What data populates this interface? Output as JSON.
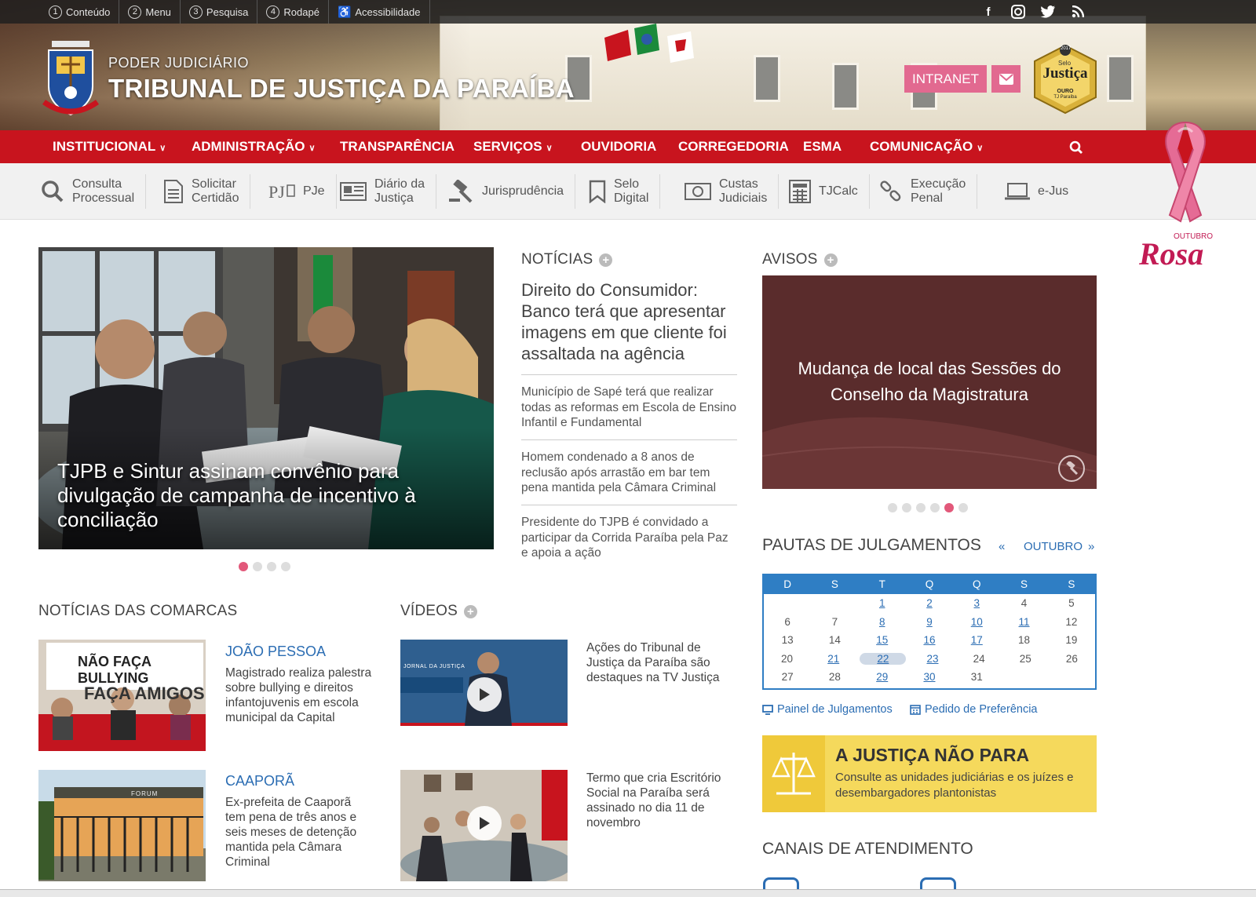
{
  "topbar": {
    "items": [
      {
        "num": "1",
        "label": "Conteúdo"
      },
      {
        "num": "2",
        "label": "Menu"
      },
      {
        "num": "3",
        "label": "Pesquisa"
      },
      {
        "num": "4",
        "label": "Rodapé"
      },
      {
        "num": "",
        "label": "Acessibilidade"
      }
    ],
    "social": [
      "facebook-icon",
      "instagram-icon",
      "twitter-icon",
      "rss-icon"
    ]
  },
  "header": {
    "line1": "PODER JUDICIÁRIO",
    "line2": "TRIBUNAL DE JUSTIÇA DA PARAÍBA",
    "intranet": "INTRANET",
    "seal": {
      "top": "Selo",
      "main": "Justiça",
      "year": "2017",
      "level": "OURO",
      "sub": "TJ Paraíba"
    }
  },
  "nav": {
    "items": [
      {
        "label": "INSTITUCIONAL",
        "dropdown": true
      },
      {
        "label": "ADMINISTRAÇÃO",
        "dropdown": true
      },
      {
        "label": "TRANSPARÊNCIA",
        "dropdown": false
      },
      {
        "label": "SERVIÇOS",
        "dropdown": true
      },
      {
        "label": "OUVIDORIA",
        "dropdown": false
      },
      {
        "label": "CORREGEDORIA",
        "dropdown": false
      },
      {
        "label": "ESMA",
        "dropdown": false
      },
      {
        "label": "COMUNICAÇÃO",
        "dropdown": true
      }
    ]
  },
  "services": [
    {
      "l1": "Consulta",
      "l2": "Processual",
      "icon": "search-icon"
    },
    {
      "l1": "Solicitar",
      "l2": "Certidão",
      "icon": "document-icon"
    },
    {
      "l1": "PJe",
      "l2": "",
      "icon": "pje-icon"
    },
    {
      "l1": "Diário da",
      "l2": "Justiça",
      "icon": "newspaper-icon"
    },
    {
      "l1": "Jurisprudência",
      "l2": "",
      "icon": "gavel-icon"
    },
    {
      "l1": "Selo",
      "l2": "Digital",
      "icon": "bookmark-icon"
    },
    {
      "l1": "Custas",
      "l2": "Judiciais",
      "icon": "money-icon"
    },
    {
      "l1": "TJCalc",
      "l2": "",
      "icon": "calculator-icon"
    },
    {
      "l1": "Execução",
      "l2": "Penal",
      "icon": "link-icon"
    },
    {
      "l1": "e-Jus",
      "l2": "",
      "icon": "laptop-icon"
    }
  ],
  "ribbon": {
    "top": "OUTUBRO",
    "main": "Rosa"
  },
  "hero": {
    "caption": "TJPB e Sintur assinam convênio para divulgação de campanha de incentivo à conciliação"
  },
  "news": {
    "title": "NOTÍCIAS",
    "main": "Direito do Consumidor: Banco terá que apresentar imagens em que cliente foi assaltada na agência",
    "items": [
      "Município de Sapé terá que realizar todas as reformas em Escola de Ensino Infantil e Fundamental",
      "Homem condenado a 8 anos de reclusão após arrastão em bar tem pena mantida pela Câmara Criminal",
      "Presidente do TJPB é convidado a participar da Corrida Paraíba pela Paz e apoia a ação"
    ]
  },
  "avisos": {
    "title": "AVISOS",
    "text": "Mudança de local das Sessões do Conselho da Magistratura"
  },
  "pautas": {
    "title": "PAUTAS DE JULGAMENTOS",
    "month": "OUTUBRO",
    "prev": "«",
    "next": "»",
    "weekdays": [
      "D",
      "S",
      "T",
      "Q",
      "Q",
      "S",
      "S"
    ],
    "weeks": [
      [
        "",
        "",
        "1",
        "2",
        "3",
        "4",
        "5"
      ],
      [
        "6",
        "7",
        "8",
        "9",
        "10",
        "11",
        "12"
      ],
      [
        "13",
        "14",
        "15",
        "16",
        "17",
        "18",
        "19"
      ],
      [
        "20",
        "21",
        "22",
        "23",
        "24",
        "25",
        "26"
      ],
      [
        "27",
        "28",
        "29",
        "30",
        "31",
        "",
        ""
      ]
    ],
    "links": [
      "1",
      "2",
      "3",
      "8",
      "9",
      "10",
      "11",
      "15",
      "16",
      "17",
      "21",
      "22",
      "23",
      "29",
      "30"
    ],
    "today": "22",
    "painel": "Painel de Julgamentos",
    "preferencia": "Pedido de Preferência"
  },
  "justica": {
    "title": "A JUSTIÇA NÃO PARA",
    "text": "Consulte as unidades judiciárias e os juízes e desembargadores plantonistas"
  },
  "comarcas": {
    "title": "NOTÍCIAS DAS COMARCAS",
    "items": [
      {
        "city": "JOÃO PESSOA",
        "text": "Magistrado realiza palestra sobre bullying e direitos infantojuvenis em escola municipal da Capital",
        "banner1": "NÃO FAÇA BULLYING",
        "banner2": "FAÇA AMIGOS"
      },
      {
        "city": "CAAPORÃ",
        "text": "Ex-prefeita de Caaporã tem pena de três anos e seis meses de detenção mantida pela Câmara Criminal",
        "banner1": "FORUM",
        "banner2": ""
      }
    ]
  },
  "videos": {
    "title": "VÍDEOS",
    "items": [
      {
        "text": "Ações do Tribunal de Justiça da Paraíba são destaques na TV Justiça",
        "overlay": "JORNAL DA JUSTIÇA"
      },
      {
        "text": "Termo que cria Escritório Social na Paraíba será assinado no dia 11 de novembro",
        "overlay": ""
      }
    ]
  },
  "canais": {
    "title": "CANAIS DE ATENDIMENTO"
  },
  "colors": {
    "red": "#c8141e",
    "pink": "#e26990",
    "blue": "#2f7ec4",
    "aviso": "#5a2c2c",
    "yellow": "#f5d95c"
  }
}
